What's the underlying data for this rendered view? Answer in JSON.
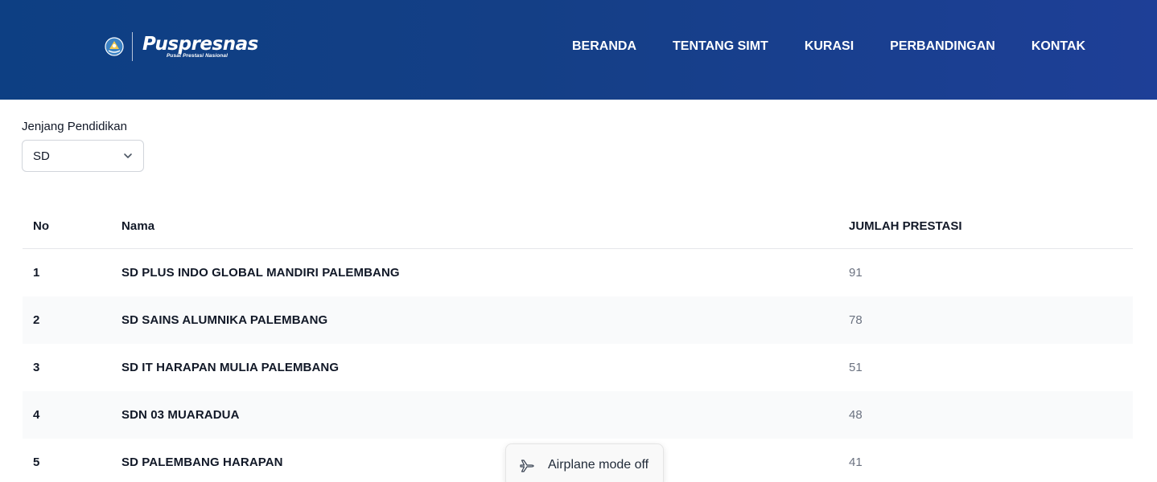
{
  "header": {
    "logo": {
      "name": "Puspresnas",
      "subtitle": "Pusat Prestasi Nasional"
    },
    "nav": [
      {
        "label": "BERANDA"
      },
      {
        "label": "TENTANG SIMT"
      },
      {
        "label": "KURASI"
      },
      {
        "label": "PERBANDINGAN"
      },
      {
        "label": "KONTAK"
      }
    ],
    "gradient_colors": [
      "#0d3f83",
      "#1e3f97"
    ]
  },
  "filter": {
    "label": "Jenjang Pendidikan",
    "selected": "SD"
  },
  "table": {
    "columns": {
      "no": "No",
      "name": "Nama",
      "count": "JUMLAH PRESTASI"
    },
    "rows": [
      {
        "no": "1",
        "name": "SD PLUS INDO GLOBAL MANDIRI PALEMBANG",
        "count": "91"
      },
      {
        "no": "2",
        "name": "SD SAINS ALUMNIKA PALEMBANG",
        "count": "78"
      },
      {
        "no": "3",
        "name": "SD IT HARAPAN MULIA PALEMBANG",
        "count": "51"
      },
      {
        "no": "4",
        "name": "SDN 03 MUARADUA",
        "count": "48"
      },
      {
        "no": "5",
        "name": "SD PALEMBANG HARAPAN",
        "count": "41"
      }
    ]
  },
  "toast": {
    "icon": "airplane-icon",
    "text": "Airplane mode off"
  }
}
